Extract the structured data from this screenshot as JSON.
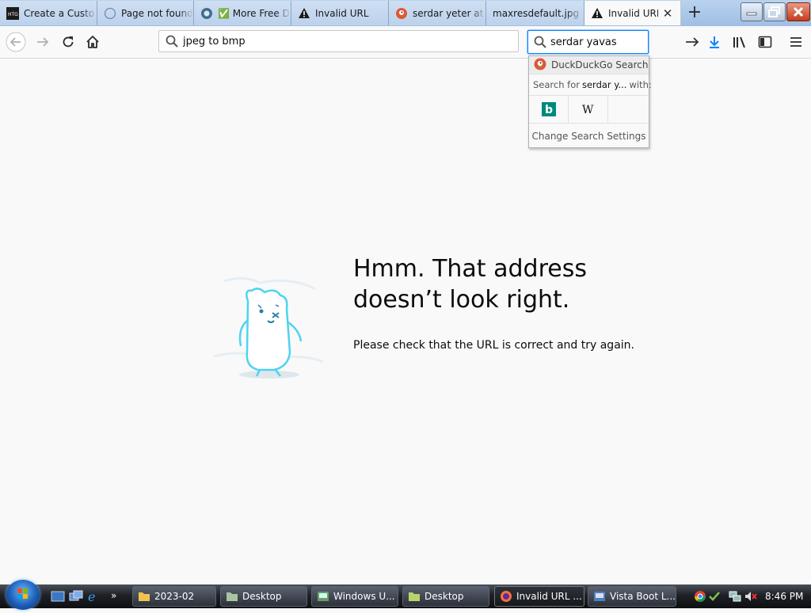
{
  "tabs": [
    {
      "title": "Create a Custo",
      "icon": "htg-icon",
      "active": false
    },
    {
      "title": "Page not found",
      "icon": "loading-icon",
      "active": false
    },
    {
      "title": "✅ More Free D",
      "icon": "site-icon",
      "active": false
    },
    {
      "title": "Invalid URL",
      "icon": "warning-icon",
      "active": false
    },
    {
      "title": "serdar yeter at",
      "icon": "duckduckgo-icon",
      "active": false
    },
    {
      "title": "maxresdefault.jpg",
      "icon": "",
      "active": false
    },
    {
      "title": "Invalid URL",
      "icon": "warning-icon",
      "active": true
    }
  ],
  "new_tab_label": "+",
  "urlbar": {
    "value": "jpeg to bmp"
  },
  "searchbar": {
    "value": "serdar yavas"
  },
  "search_popup": {
    "engine_label": "DuckDuckGo Search",
    "search_for_prefix": "Search for",
    "search_for_query": "serdar y...",
    "search_for_suffix": "with:",
    "engines": [
      {
        "name": "bing",
        "glyph": "b"
      },
      {
        "name": "wikipedia",
        "glyph": "W"
      }
    ],
    "settings_label": "Change Search Settings"
  },
  "error": {
    "title_line1": "Hmm. That address",
    "title_line2": "doesn’t look right.",
    "description": "Please check that the URL is correct and try again."
  },
  "taskbar": {
    "quicklaunch_more": "»",
    "buttons": [
      {
        "label": "2023-02",
        "icon": "folder-icon",
        "active": false
      },
      {
        "label": "Desktop",
        "icon": "folder-icon",
        "active": false
      },
      {
        "label": "Windows U...",
        "icon": "app-icon",
        "active": false
      },
      {
        "label": "Desktop",
        "icon": "folder-icon",
        "active": false
      },
      {
        "label": "Invalid URL ...",
        "icon": "firefox-icon",
        "active": true
      },
      {
        "label": "Vista Boot L...",
        "icon": "app-icon",
        "active": false
      }
    ],
    "clock": "8:46 PM"
  },
  "colors": {
    "accent": "#0a84ff",
    "download": "#0a84ff",
    "titlebar": "#a9c6e8",
    "bing": "#00897b",
    "mascot": "#4fd3f0"
  }
}
